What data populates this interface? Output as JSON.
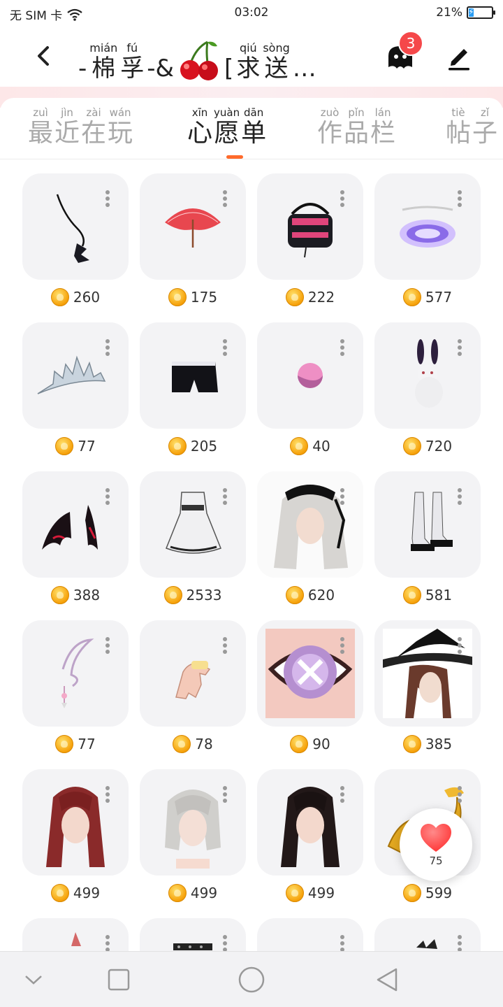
{
  "status_bar": {
    "carrier": "无 SIM 卡",
    "time": "03:02",
    "battery": "21%",
    "battery_level": 0.21
  },
  "header": {
    "title_parts": [
      {
        "type": "plain",
        "text": "-"
      },
      {
        "type": "ruby",
        "hz": "棉",
        "py": "mián"
      },
      {
        "type": "ruby",
        "hz": "孚",
        "py": "fú"
      },
      {
        "type": "plain",
        "text": "-&"
      },
      {
        "type": "emoji",
        "name": "cherry-emoji"
      },
      {
        "type": "plain",
        "text": "["
      },
      {
        "type": "ruby",
        "hz": "求",
        "py": "qiú"
      },
      {
        "type": "ruby",
        "hz": "送",
        "py": "sòng"
      },
      {
        "type": "plain",
        "text": "…"
      }
    ],
    "message_badge": "3",
    "icons": {
      "back": "back-arrow-icon",
      "message": "ghost-message-icon",
      "edit": "pen-edit-icon"
    }
  },
  "tabs": [
    {
      "label": "最近在玩",
      "chars": [
        [
          "最",
          "zuì"
        ],
        [
          "近",
          "jìn"
        ],
        [
          "在",
          "zài"
        ],
        [
          "玩",
          "wán"
        ]
      ],
      "active": false
    },
    {
      "label": "心愿单",
      "chars": [
        [
          "心",
          "xīn"
        ],
        [
          "愿",
          "yuàn"
        ],
        [
          "单",
          "dān"
        ]
      ],
      "active": true
    },
    {
      "label": "作品栏",
      "chars": [
        [
          "作",
          "zuò"
        ],
        [
          "品",
          "pǐn"
        ],
        [
          "栏",
          "lán"
        ]
      ],
      "active": false
    },
    {
      "label": "帖子",
      "chars": [
        [
          "帖",
          "tiè"
        ],
        [
          "子",
          "zǐ"
        ]
      ],
      "active": false
    }
  ],
  "items": [
    {
      "name": "tail",
      "price": "260"
    },
    {
      "name": "umbrella",
      "price": "175"
    },
    {
      "name": "bag",
      "price": "222"
    },
    {
      "name": "halo",
      "price": "577"
    },
    {
      "name": "tiara",
      "price": "77"
    },
    {
      "name": "shorts",
      "price": "205"
    },
    {
      "name": "blush",
      "price": "40"
    },
    {
      "name": "rabbit",
      "price": "720"
    },
    {
      "name": "wings",
      "price": "388"
    },
    {
      "name": "dress",
      "price": "2533"
    },
    {
      "name": "maid-hair",
      "price": "620"
    },
    {
      "name": "boots",
      "price": "581"
    },
    {
      "name": "earring",
      "price": "77"
    },
    {
      "name": "glove",
      "price": "78"
    },
    {
      "name": "eye",
      "price": "90"
    },
    {
      "name": "witch-hat",
      "price": "385"
    },
    {
      "name": "red-hair",
      "price": "499"
    },
    {
      "name": "silver-bob",
      "price": "499"
    },
    {
      "name": "black-hair",
      "price": "499"
    },
    {
      "name": "dragon",
      "price": "599"
    },
    {
      "name": "partial-1",
      "price": ""
    },
    {
      "name": "partial-2",
      "price": ""
    },
    {
      "name": "partial-3",
      "price": ""
    },
    {
      "name": "partial-4",
      "price": ""
    }
  ],
  "fab": {
    "count": "75",
    "icon": "heart-icon"
  },
  "nav": {
    "icons": [
      "collapse-down-icon",
      "recents-square-icon",
      "home-circle-icon",
      "back-triangle-icon"
    ]
  },
  "colors": {
    "accent": "#ff6a2b",
    "badge": "#f5484a",
    "heart": "#ff3b3b",
    "coin": "#f6a10a"
  }
}
